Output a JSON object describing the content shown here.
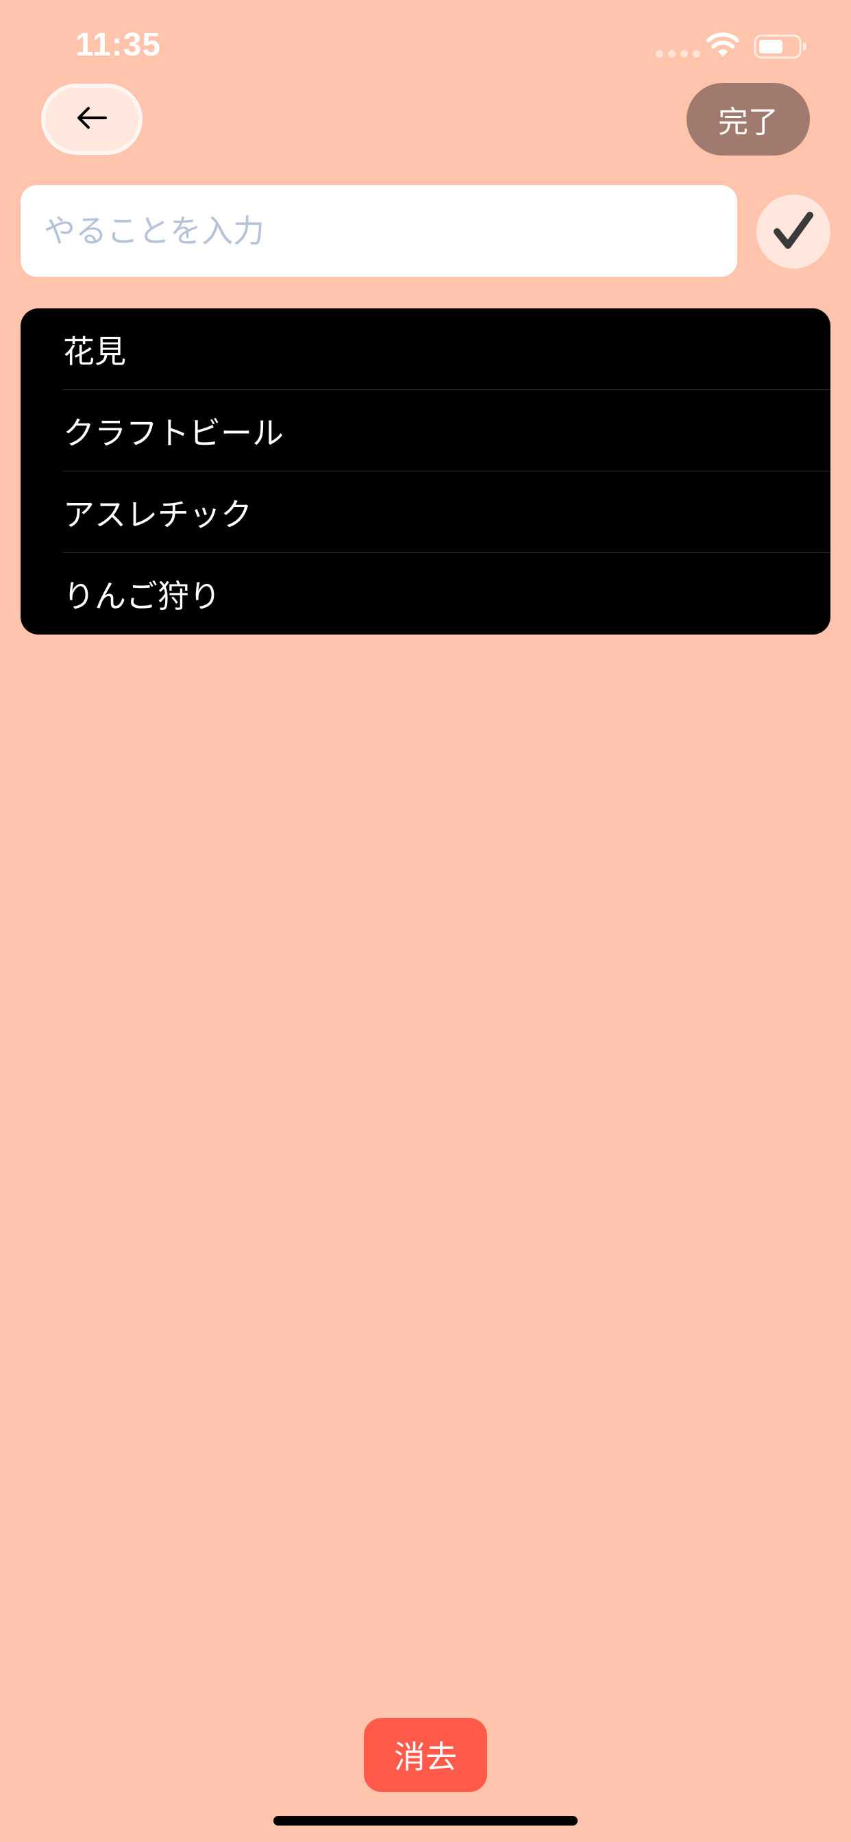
{
  "status_bar": {
    "time": "11:35"
  },
  "header": {
    "back_icon": "arrow-left-icon",
    "done_label": "完了"
  },
  "input": {
    "placeholder": "やることを入力",
    "value": "",
    "confirm_icon": "checkmark-icon"
  },
  "todo_items": [
    {
      "label": "花見"
    },
    {
      "label": "クラフトビール"
    },
    {
      "label": "アスレチック"
    },
    {
      "label": "りんご狩り"
    }
  ],
  "footer": {
    "delete_label": "消去"
  },
  "colors": {
    "background": "#FFC4AB",
    "done_button": "#A07A6E",
    "delete_button": "#FF5A4A",
    "list_background": "#000000",
    "placeholder": "#B5C3D9"
  }
}
